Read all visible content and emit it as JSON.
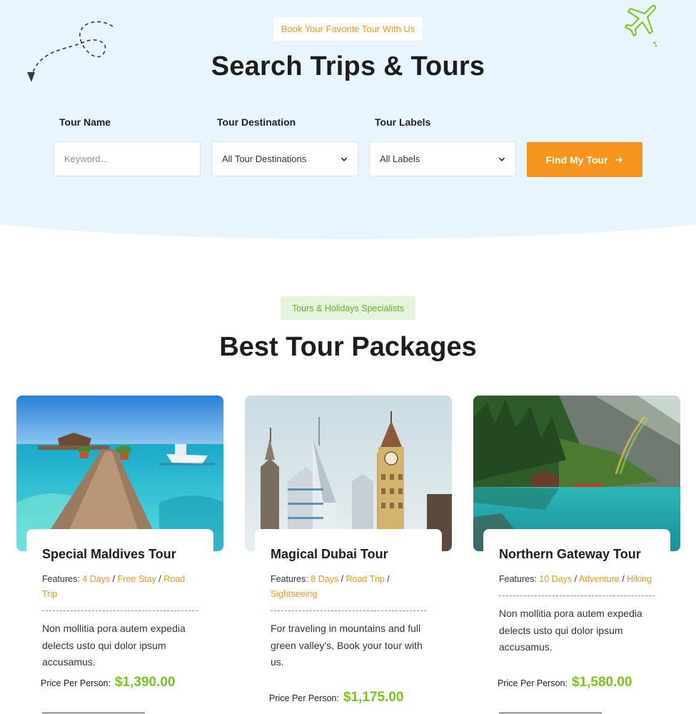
{
  "hero": {
    "badge": "Book Your Favorite Tour With Us",
    "title": "Search Trips & Tours"
  },
  "search": {
    "tour_name_label": "Tour Name",
    "tour_name_placeholder": "Keyword...",
    "destination_label": "Tour Destination",
    "destination_value": "All Tour Destinations",
    "labels_label": "Tour Labels",
    "labels_value": "All Labels",
    "submit_label": "Find My Tour",
    "submit_icon": "arrow-right-icon"
  },
  "packages": {
    "badge": "Tours & Holidays Specialists",
    "title": "Best Tour Packages",
    "features_prefix": "Features:",
    "price_label": "Price Per Person:",
    "cards": [
      {
        "title": "Special Maldives Tour",
        "features": [
          "4 Days",
          "Free Stay",
          "Road Trip"
        ],
        "description": "Non mollitia pora autem expedia delects usto qui dolor ipsum accusamus.",
        "price": "$1,390.00"
      },
      {
        "title": "Magical Dubai Tour",
        "features": [
          "8 Days",
          "Road Trip",
          "Sightseeing"
        ],
        "description": "For traveling in mountains and full green valley's, Book your tour with us.",
        "price": "$1,175.00"
      },
      {
        "title": "Northern Gateway Tour",
        "features": [
          "10 Days",
          "Adventure",
          "Hiking"
        ],
        "description": "Non mollitia pora autem expedia delects usto qui dolor ipsum accusamus.",
        "price": "$1,580.00"
      }
    ]
  },
  "colors": {
    "accent_orange": "#f7941d",
    "accent_green": "#7bc41c",
    "hero_bg": "#e9f5fe"
  }
}
